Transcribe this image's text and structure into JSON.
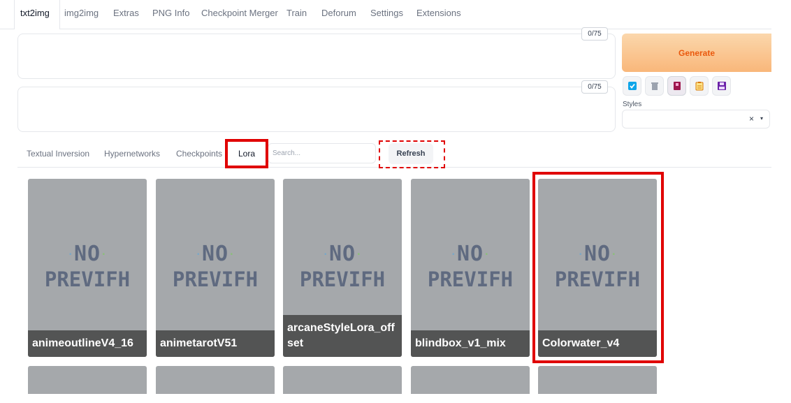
{
  "top_tabs": [
    "txt2img",
    "img2img",
    "Extras",
    "PNG Info",
    "Checkpoint Merger",
    "Train",
    "Deforum",
    "Settings",
    "Extensions"
  ],
  "prompt": {
    "token_count": "0/75",
    "value": ""
  },
  "negative_prompt": {
    "token_count": "0/75",
    "value": ""
  },
  "generate_label": "Generate",
  "tool_icons": [
    "checkbox-icon",
    "trash-icon",
    "show-extra-networks-icon",
    "clipboard-icon",
    "save-icon"
  ],
  "tool_colors": {
    "blue": "#0ea5e9",
    "gray": "#9ca3af",
    "magenta": "#9d174d",
    "amber": "#d97706",
    "purple": "#6b21a8"
  },
  "styles": {
    "label": "Styles",
    "clear": "×",
    "caret": "▾"
  },
  "network_tabs": [
    "Textual Inversion",
    "Hypernetworks",
    "Checkpoints",
    "Lora"
  ],
  "active_network_tab": "Lora",
  "search": {
    "placeholder": "Search...",
    "value": ""
  },
  "refresh_label": "Refresh",
  "no_preview": {
    "line1": "NO",
    "line2": "PREVIEW",
    "glyph_line2": "PREVIFH"
  },
  "cards": [
    {
      "name": "animeoutlineV4_16"
    },
    {
      "name": "animetarotV51"
    },
    {
      "name": "arcaneStyleLora_offset"
    },
    {
      "name": "blindbox_v1_mix"
    },
    {
      "name": "Colorwater_v4"
    }
  ],
  "accent_colors": {
    "annotation_red": "#e00000",
    "generate_text": "#ea580c"
  }
}
